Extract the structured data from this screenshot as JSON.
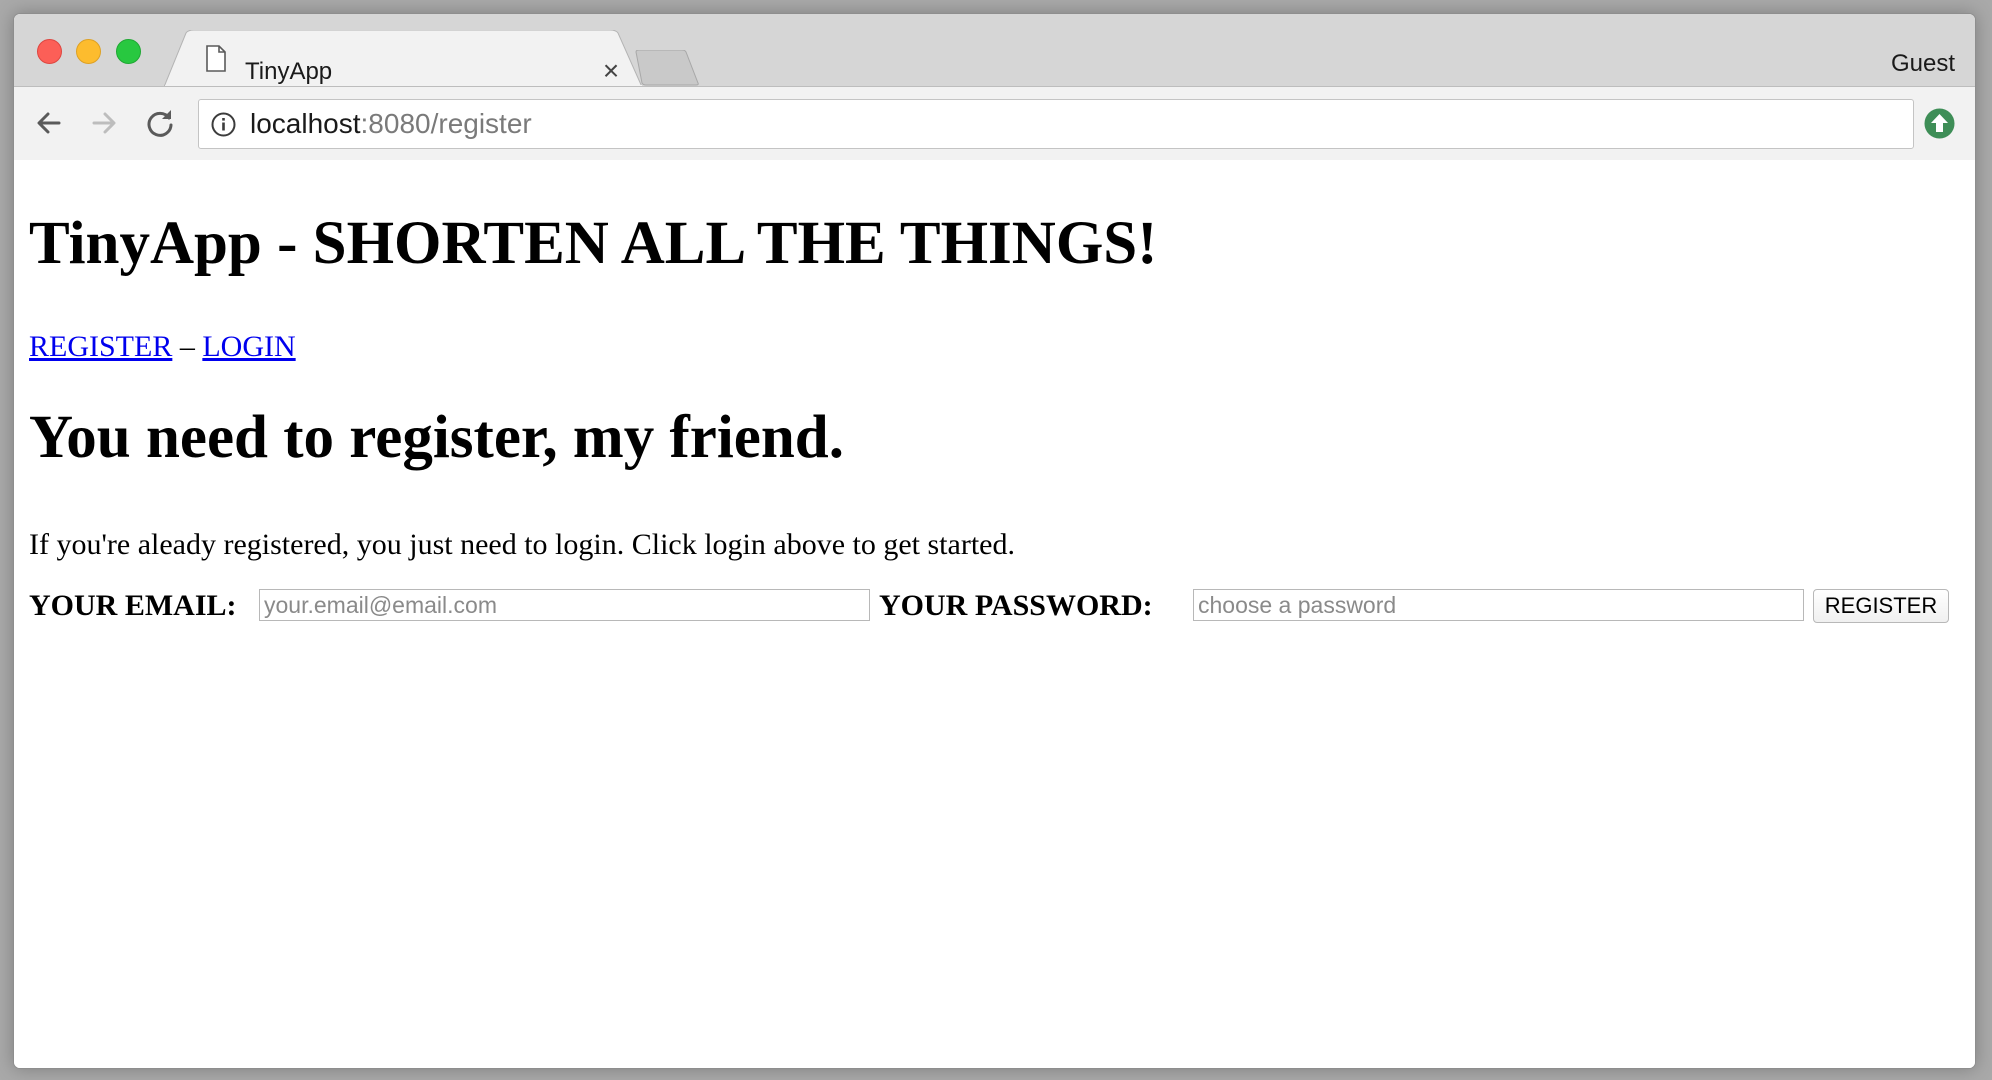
{
  "browser": {
    "tab_title": "TinyApp",
    "profile_label": "Guest",
    "url_host": "localhost",
    "url_rest": ":8080/register",
    "icons": [
      "close-window-icon",
      "minimize-icon",
      "zoom-icon",
      "page-icon",
      "tab-close-icon",
      "back-arrow-icon",
      "forward-arrow-icon",
      "reload-icon",
      "info-icon",
      "update-icon"
    ],
    "colors": {
      "close": "#fc5f57",
      "minimize": "#fdbc2e",
      "zoom": "#28c840",
      "update": "#3e8e57"
    }
  },
  "page": {
    "title": "TinyApp - SHORTEN ALL THE THINGS!",
    "nav": {
      "register_label": "REGISTER",
      "separator": "–",
      "login_label": "LOGIN",
      "link_color": "#0000ee"
    },
    "heading": "You need to register, my friend.",
    "intro": "If you're aleady registered, you just need to login. Click login above to get started.",
    "form": {
      "email_label": "YOUR EMAIL:",
      "email_placeholder": "your.email@email.com",
      "email_value": "",
      "password_label": "YOUR PASSWORD:",
      "password_placeholder": "choose a password",
      "password_value": "",
      "submit_label": "REGISTER"
    }
  }
}
